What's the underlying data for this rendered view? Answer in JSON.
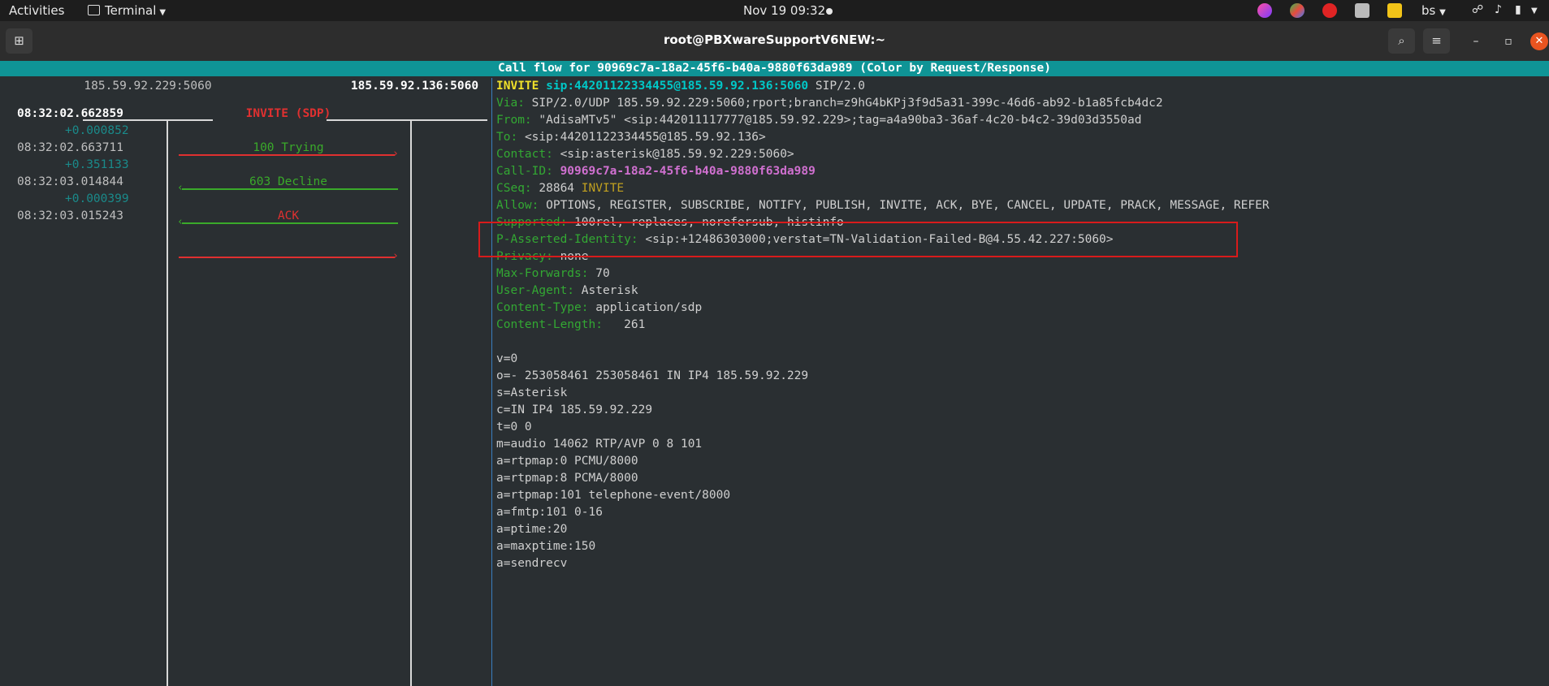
{
  "topbar": {
    "activities": "Activities",
    "app": "Terminal",
    "clock": "Nov 19  09:32",
    "keyboard": "bs"
  },
  "window": {
    "title": "root@PBXwareSupportV6NEW:~"
  },
  "callflow": {
    "title": "Call flow for 90969c7a-18a2-45f6-b40a-9880f63da989 (Color by Request/Response)",
    "host_left": "185.59.92.229:5060",
    "host_right": "185.59.92.136:5060",
    "events": [
      {
        "time": "08:32:02.662859",
        "delta": "+0.000852",
        "label": "INVITE (SDP)",
        "direction": "right",
        "color": "#e03030"
      },
      {
        "time": "08:32:02.663711",
        "delta": "+0.351133",
        "label": "100 Trying",
        "direction": "left",
        "color": "#3aaa2a"
      },
      {
        "time": "08:32:03.014844",
        "delta": "+0.000399",
        "label": "603 Decline",
        "direction": "left",
        "color": "#3aaa2a"
      },
      {
        "time": "08:32:03.015243",
        "delta": "",
        "label": "ACK",
        "direction": "right",
        "color": "#e03030"
      }
    ]
  },
  "sip": {
    "request_method": "INVITE",
    "request_uri": "sip:44201122334455@185.59.92.136:5060",
    "request_version": "SIP/2.0",
    "headers": [
      {
        "name": "Via:",
        "value": "SIP/2.0/UDP 185.59.92.229:5060;rport;branch=z9hG4bKPj3f9d5a31-399c-46d6-ab92-b1a85fcb4dc2"
      },
      {
        "name": "From:",
        "value": "\"AdisaMTv5\" <sip:442011117777@185.59.92.229>;tag=a4a90ba3-36af-4c20-b4c2-39d03d3550ad"
      },
      {
        "name": "To:",
        "value": "<sip:44201122334455@185.59.92.136>"
      },
      {
        "name": "Contact:",
        "value": "<sip:asterisk@185.59.92.229:5060>"
      },
      {
        "name": "Call-ID:",
        "value": "90969c7a-18a2-45f6-b40a-9880f63da989"
      },
      {
        "name": "CSeq:",
        "value": "28864",
        "value2": "INVITE"
      },
      {
        "name": "Allow:",
        "value": "OPTIONS, REGISTER, SUBSCRIBE, NOTIFY, PUBLISH, INVITE, ACK, BYE, CANCEL, UPDATE, PRACK, MESSAGE, REFER"
      },
      {
        "name": "Supported:",
        "value": "100rel, replaces, norefersub, histinfo"
      },
      {
        "name": "P-Asserted-Identity:",
        "value": "<sip:+12486303000;verstat=TN-Validation-Failed-B@4.55.42.227:5060>"
      },
      {
        "name": "Privacy:",
        "value": "none"
      },
      {
        "name": "Max-Forwards:",
        "value": "70"
      },
      {
        "name": "User-Agent:",
        "value": "Asterisk"
      },
      {
        "name": "Content-Type:",
        "value": "application/sdp"
      },
      {
        "name": "Content-Length:",
        "value": "  261"
      }
    ],
    "body": [
      "v=0",
      "o=- 253058461 253058461 IN IP4 185.59.92.229",
      "s=Asterisk",
      "c=IN IP4 185.59.92.229",
      "t=0 0",
      "m=audio 14062 RTP/AVP 0 8 101",
      "a=rtpmap:0 PCMU/8000",
      "a=rtpmap:8 PCMA/8000",
      "a=rtpmap:101 telephone-event/8000",
      "a=fmtp:101 0-16",
      "a=ptime:20",
      "a=maxptime:150",
      "a=sendrecv"
    ]
  }
}
